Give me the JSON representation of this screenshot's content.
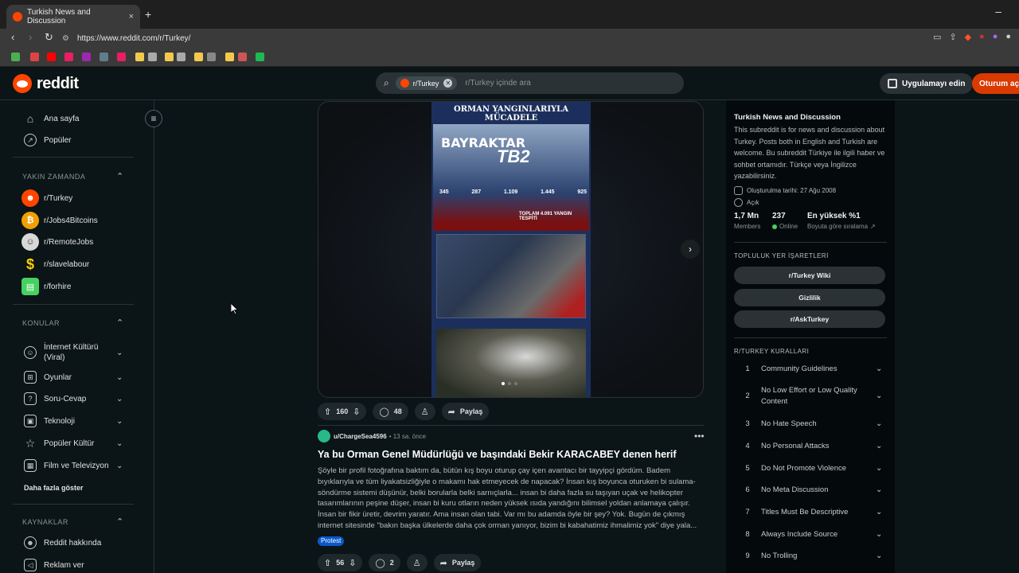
{
  "browser": {
    "tab_title": "Turkish News and Discussion",
    "tab_close": "×",
    "new_tab": "+",
    "minimize": "–",
    "url": "https://www.reddit.com/r/Turkey/"
  },
  "header": {
    "logo_text": "reddit",
    "search_chip": "r/Turkey",
    "search_placeholder": "r/Turkey içinde ara",
    "get_app": "Uygulamayı edin",
    "login": "Oturum aç"
  },
  "leftnav": {
    "home": "Ana sayfa",
    "popular": "Popüler",
    "recent_title": "YAKIN ZAMANDA",
    "recent": [
      {
        "label": "r/Turkey",
        "color": "#ff4500"
      },
      {
        "label": "r/Jobs4Bitcoins",
        "color": "#f0a000"
      },
      {
        "label": "r/RemoteJobs",
        "color": "#d8d8d8"
      },
      {
        "label": "r/slavelabour",
        "color": "#ffd000"
      },
      {
        "label": "r/forhire",
        "color": "#46d160"
      }
    ],
    "topics_title": "KONULAR",
    "topics": [
      {
        "label": "İnternet Kültürü (Viral)",
        "icon": "smile-icon"
      },
      {
        "label": "Oyunlar",
        "icon": "gamepad-icon"
      },
      {
        "label": "Soru-Cevap",
        "icon": "question-icon"
      },
      {
        "label": "Teknoloji",
        "icon": "chip-icon"
      },
      {
        "label": "Popüler Kültür",
        "icon": "star-icon"
      },
      {
        "label": "Film ve Televizyon",
        "icon": "film-icon"
      }
    ],
    "show_more": "Daha fazla göster",
    "resources_title": "KAYNAKLAR",
    "resources": [
      {
        "label": "Reddit hakkında"
      },
      {
        "label": "Reklam ver"
      }
    ]
  },
  "post1": {
    "poster_heading": "ORMAN YANGINLARIYLA MÜCADELE",
    "poster_brand": "BAYRAKTAR",
    "poster_model": "TB2",
    "poster_stats": [
      "345",
      "287",
      "1.109",
      "1.445",
      "925"
    ],
    "poster_total": "TOPLAM 4.091 YANGIN TESPİTİ",
    "votes": "160",
    "comments": "48",
    "share": "Paylaş"
  },
  "post2": {
    "user": "u/ChargeSea4596",
    "time": "• 13 sa. önce",
    "more": "•••",
    "title": "Ya bu Orman Genel Müdürlüğü ve başındaki Bekir KARACABEY denen herif",
    "body": "Şöyle bir profil fotoğrafına baktım da, bütün kış boyu oturup çay içen avantacı bir tayyipçi gördüm. Badem bıyıklarıyla ve tüm liyakatsizliğiyle o makamı hak etmeyecek de napacak? İnsan kış boyunca oturuken bi sulama-söndürme sistemi düşünür, belki borularla belki sarnıçlarla... insan bi daha fazla su taşıyan uçak ve helikopter tasarımlarının peşine düşer, insan bi kuru otların neden yüksek ısıda yandığını bilimsel yoldan anlamaya çalışır. İnsan bir fikir üretir, devrim yaratır. Ama insan olan tabi. Var mı bu adamda öyle bir şey? Yok. Bugün de çıkmış internet sitesinde \"bakın başka ülkelerde daha çok orman yanıyor, bizim bi kabahatimiz ihmalimiz yok\" diye yala...",
    "flair": "Protest",
    "votes": "56",
    "comments": "2",
    "share": "Paylaş"
  },
  "sidebar": {
    "title": "Turkish News and Discussion",
    "description": "This subreddit is for news and discussion about Turkey. Posts both in English and Turkish are welcome. Bu subreddit Türkiye ile ilgili haber ve sohbet ortamıdır. Türkçe veya İngilizce yazabilirsiniz.",
    "created": "Oluşturulma tarihi: 27 Ağu 2008",
    "visibility": "Açık",
    "members_value": "1,7 Mn",
    "members_label": "Members",
    "online_value": "237",
    "online_label": "Online",
    "rank_value": "En yüksek %1",
    "rank_label": "Boyuta göre sıralama",
    "bookmarks_title": "TOPLULUK YER İŞARETLERİ",
    "bookmarks": [
      "r/Turkey Wiki",
      "Gizlilik",
      "r/AskTurkey"
    ],
    "rules_title": "R/TURKEY KURALLARI",
    "rules": [
      {
        "n": "1",
        "t": "Community Guidelines"
      },
      {
        "n": "2",
        "t": "No Low Effort or Low Quality Content"
      },
      {
        "n": "3",
        "t": "No Hate Speech"
      },
      {
        "n": "4",
        "t": "No Personal Attacks"
      },
      {
        "n": "5",
        "t": "Do Not Promote Violence"
      },
      {
        "n": "6",
        "t": "No Meta Discussion"
      },
      {
        "n": "7",
        "t": "Titles Must Be Descriptive"
      },
      {
        "n": "8",
        "t": "Always Include Source"
      },
      {
        "n": "9",
        "t": "No Trolling"
      }
    ]
  }
}
